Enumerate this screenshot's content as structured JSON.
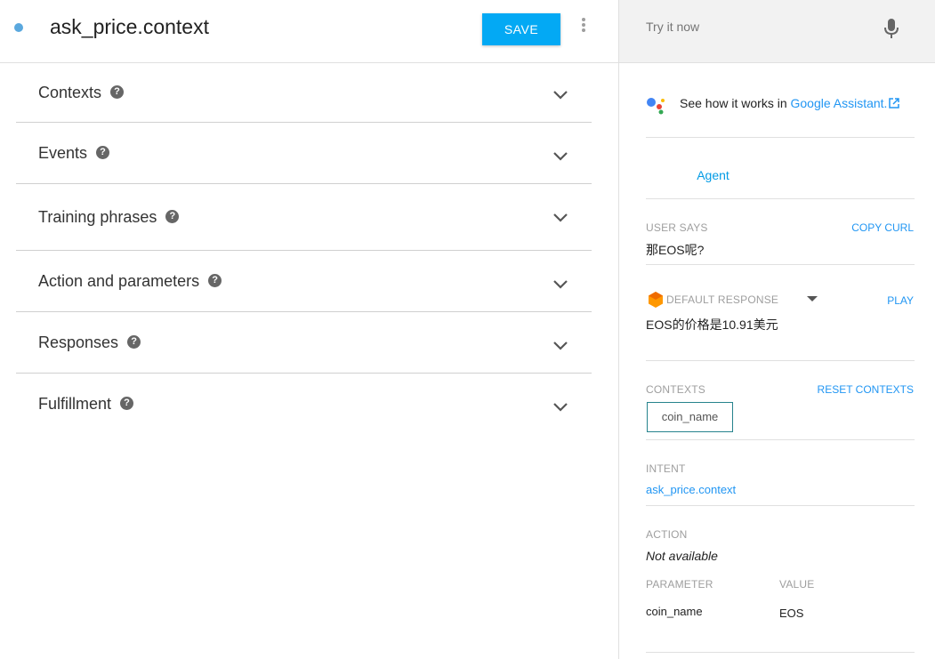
{
  "header": {
    "title": "ask_price.context",
    "save_label": "SAVE"
  },
  "sections": [
    {
      "label": "Contexts"
    },
    {
      "label": "Events"
    },
    {
      "label": "Training phrases"
    },
    {
      "label": "Action and parameters"
    },
    {
      "label": "Responses"
    },
    {
      "label": "Fulfillment"
    }
  ],
  "try_panel": {
    "placeholder": "Try it now",
    "assistant_text": "See how it works in ",
    "assistant_link": "Google Assistant.",
    "tab_agent": "Agent",
    "user_says_label": "USER SAYS",
    "copy_curl": "COPY CURL",
    "user_says_value": "那EOS呢?",
    "default_response_label": "DEFAULT RESPONSE",
    "play": "PLAY",
    "response_value": "EOS的价格是10.91美元",
    "contexts_label": "CONTEXTS",
    "reset_contexts": "RESET CONTEXTS",
    "context_chip": "coin_name",
    "intent_label": "INTENT",
    "intent_value": "ask_price.context",
    "action_label": "ACTION",
    "action_value": "Not available",
    "parameter_label": "PARAMETER",
    "value_label": "VALUE",
    "parameter_name": "coin_name",
    "parameter_value": "EOS"
  },
  "colors": {
    "accent": "#03a9f4",
    "link": "#2196f3",
    "status_dot": "#5aa8de",
    "chip_border": "#26838d"
  },
  "icons": [
    "status-dot",
    "more-vert-icon",
    "help-icon",
    "chevron-down-icon",
    "mic-icon",
    "google-assistant-icon",
    "external-link-icon",
    "dialogflow-icon",
    "caret-down-icon"
  ]
}
